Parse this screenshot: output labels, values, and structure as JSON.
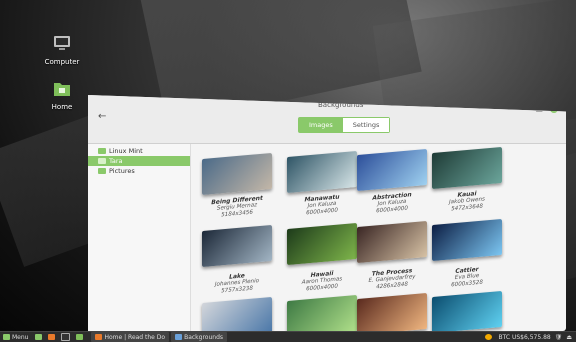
{
  "desktop": {
    "icons": [
      {
        "label": "Computer",
        "icon": "computer-icon"
      },
      {
        "label": "Home",
        "icon": "home-folder-icon"
      }
    ]
  },
  "window": {
    "title": "Backgrounds",
    "tabs": [
      {
        "label": "Images"
      },
      {
        "label": "Settings"
      }
    ],
    "sidebar": [
      {
        "label": "Linux Mint"
      },
      {
        "label": "Tara"
      },
      {
        "label": "Pictures"
      }
    ],
    "gallery": [
      {
        "name": "Being Different",
        "author": "Sergiu Mernaz",
        "size": "5184x3456",
        "colors": [
          "#4b6a88",
          "#c3b7a8"
        ]
      },
      {
        "name": "Manawatu",
        "author": "Jon Kaluza",
        "size": "6000x4000",
        "colors": [
          "#2f5566",
          "#d8e6e8"
        ]
      },
      {
        "name": "Abstraction",
        "author": "Jon Kaluza",
        "size": "6000x4000",
        "colors": [
          "#2d4f9a",
          "#9fd1f0"
        ]
      },
      {
        "name": "Kauai",
        "author": "Jakob Owens",
        "size": "5472x3648",
        "colors": [
          "#1e3b36",
          "#6ba59b"
        ]
      },
      {
        "name": "Lake",
        "author": "Johannes Plenio",
        "size": "5757x3238",
        "colors": [
          "#1c2838",
          "#a2b5c4"
        ]
      },
      {
        "name": "Hawaii",
        "author": "Aaron Thomas",
        "size": "6000x4000",
        "colors": [
          "#1d3b1a",
          "#7fb64b"
        ]
      },
      {
        "name": "The Process",
        "author": "E. Ganjevdarfrey",
        "size": "4286x2848",
        "colors": [
          "#3a2624",
          "#d7c2a5"
        ]
      },
      {
        "name": "Cattier",
        "author": "Eva Blue",
        "size": "6000x3528",
        "colors": [
          "#0c1e44",
          "#7cc6f2"
        ]
      },
      {
        "name": "",
        "author": "",
        "size": "",
        "colors": [
          "#d3d6db",
          "#4a77a8"
        ]
      },
      {
        "name": "",
        "author": "",
        "size": "",
        "colors": [
          "#3e7a44",
          "#b0e08a"
        ]
      },
      {
        "name": "",
        "author": "",
        "size": "",
        "colors": [
          "#5a2a1e",
          "#f0b680"
        ]
      },
      {
        "name": "",
        "author": "",
        "size": "",
        "colors": [
          "#0b4d6f",
          "#5fd1f1"
        ]
      }
    ]
  },
  "taskbar": {
    "menu": "Menu",
    "windows": [
      {
        "label": "Home | Read the Do"
      },
      {
        "label": "Backgrounds"
      }
    ],
    "tray_text": "BTC US$6,575.88"
  },
  "colors": {
    "accent": "#8ac96a"
  }
}
